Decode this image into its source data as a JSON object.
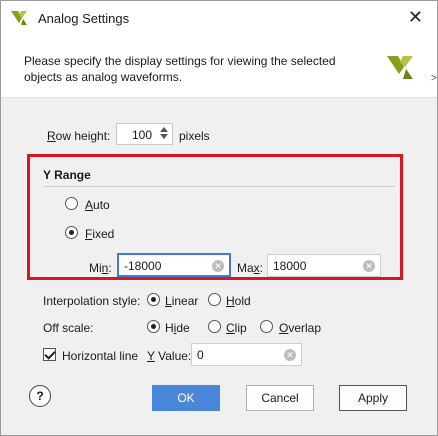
{
  "window": {
    "title": "Analog Settings",
    "close_glyph": "✕"
  },
  "header": {
    "description": "Please specify the display settings for viewing the selected objects as analog waveforms.",
    "edge_char": ">",
    "brand_color": "#8b9e1c"
  },
  "row_height": {
    "label_prefix": "",
    "label_mnemonic": "R",
    "label_rest": "ow height:",
    "value": "100",
    "unit": "pixels"
  },
  "y_range": {
    "title": "Y Range",
    "auto": {
      "mnemonic": "A",
      "rest": "uto",
      "selected": false
    },
    "fixed": {
      "mnemonic": "F",
      "rest": "ixed",
      "selected": true
    },
    "min": {
      "prefix": "Mi",
      "mnemonic": "n",
      "rest": ":",
      "value": "-18000"
    },
    "max": {
      "prefix": "Ma",
      "mnemonic": "x",
      "rest": ":",
      "value": "18000"
    }
  },
  "interpolation": {
    "label": "Interpolation style:",
    "linear": {
      "mnemonic": "L",
      "rest": "inear",
      "selected": true
    },
    "hold": {
      "mnemonic": "H",
      "rest": "old",
      "selected": false
    }
  },
  "off_scale": {
    "label": "Off scale:",
    "hide": {
      "prefix": "H",
      "mnemonic": "i",
      "rest": "de",
      "selected": true
    },
    "clip": {
      "mnemonic": "C",
      "rest": "lip",
      "selected": false
    },
    "overlap": {
      "mnemonic": "O",
      "rest": "verlap",
      "selected": false
    }
  },
  "horizontal_line": {
    "label": "Horizontal line",
    "checked": true,
    "y_mnemonic": "Y",
    "y_rest": " Value:",
    "value": "0"
  },
  "buttons": {
    "help": "?",
    "ok": "OK",
    "cancel": "Cancel",
    "apply": "Apply"
  },
  "colors": {
    "red_highlight": "#d8171f",
    "ok_blue": "#4a86d9",
    "focus_blue": "#3d7bd6"
  }
}
